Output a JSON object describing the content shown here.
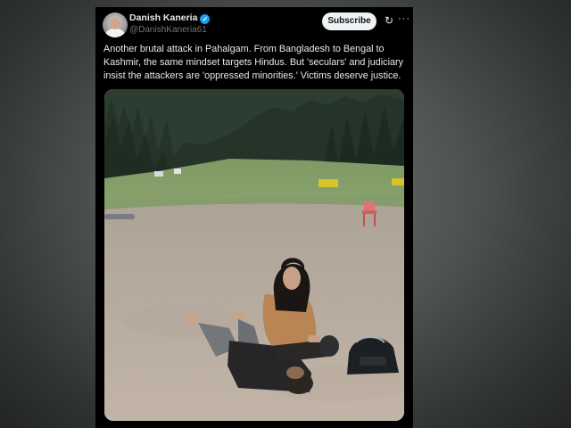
{
  "post": {
    "display_name": "Danish Kaneria",
    "verified_glyph": "✓",
    "handle": "@DanishKaneria61",
    "subscribe_label": "Subscribe",
    "grok_icon": "↻",
    "more_icon": "···",
    "text": "Another brutal attack in Pahalgam. From Bangladesh to Bengal to Kashmir, the same mindset targets Hindus. But 'seculars' and judiciary insist the attackers are 'oppressed minorities.' Victims deserve justice."
  },
  "icons": {
    "verified": "verified-badge-icon",
    "grok": "grok-icon",
    "more": "more-options-icon"
  },
  "colors": {
    "card_bg": "#000000",
    "text": "#e7e9ea",
    "handle": "#71767b",
    "verified": "#1d9bf0",
    "subscribe_bg": "#eff3f4"
  }
}
